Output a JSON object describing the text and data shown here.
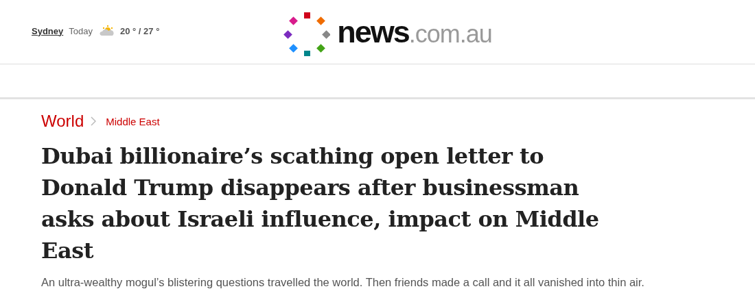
{
  "weather": {
    "city": "Sydney",
    "day": "Today",
    "temperature": "20 ° / 27 °"
  },
  "logo": {
    "brand": "news",
    "domain": ".com.au"
  },
  "breadcrumbs": [
    {
      "label": "World",
      "kind": "section"
    },
    {
      "label": "Middle East",
      "kind": "subsection"
    }
  ],
  "article": {
    "headline": "Dubai billionaire’s scathing open letter to Donald Trump disappears after businessman asks about Israeli influence, impact on Middle East",
    "standfirst": "An ultra-wealthy mogul’s blistering questions travelled the world. Then friends made a call and it all vanished into thin air."
  }
}
